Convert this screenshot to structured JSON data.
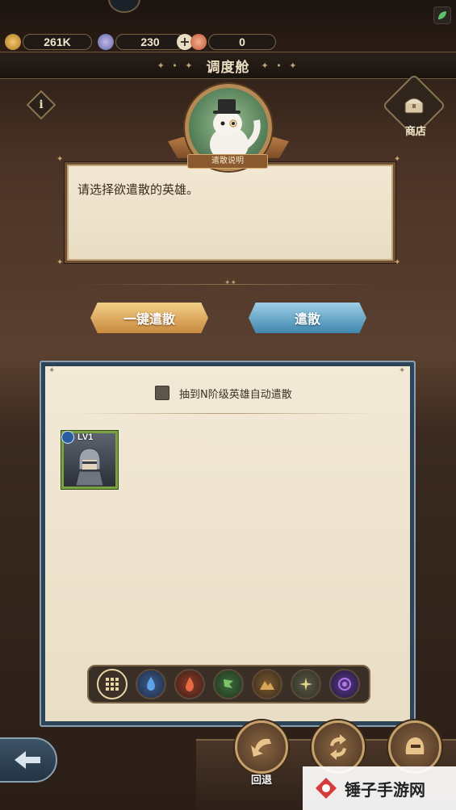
{
  "resources": {
    "gold": "261K",
    "crystal": "230",
    "feather": "0"
  },
  "header": {
    "title": "调度舱",
    "ornament": "✦ • ✦"
  },
  "shop": {
    "label": "商店"
  },
  "portrait": {
    "label": "遣散说明"
  },
  "dialog": {
    "text": "请选择欲遣散的英雄。"
  },
  "buttons": {
    "dismiss_all": "一键遣散",
    "dismiss": "遣散"
  },
  "panel": {
    "auto_dismiss_label": "抽到N阶级英雄自动遣散",
    "heroes": [
      {
        "level": "LV1",
        "element": "water"
      }
    ]
  },
  "filters": [
    "all-icon",
    "water-element-icon",
    "fire-element-icon",
    "wind-element-icon",
    "earth-element-icon",
    "light-element-icon",
    "dark-element-icon"
  ],
  "bottom": {
    "back_label": "回退"
  },
  "watermark": {
    "text": "锤子手游网"
  },
  "colors": {
    "accent_gold": "#c78a3f",
    "accent_blue": "#3f86ae",
    "panel_bg": "#f2e9d7"
  }
}
